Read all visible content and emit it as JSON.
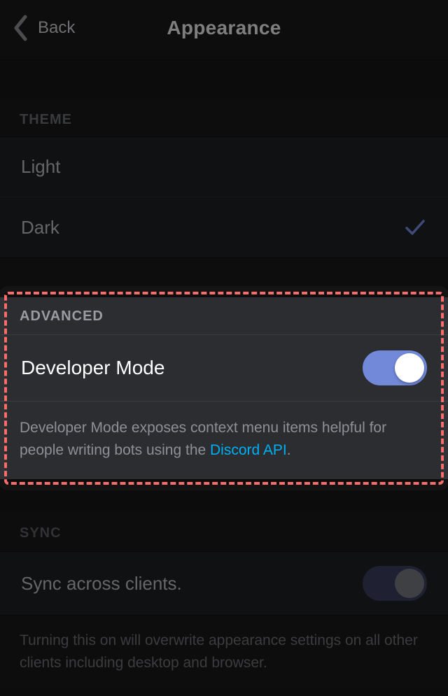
{
  "header": {
    "back_label": "Back",
    "title": "Appearance"
  },
  "theme": {
    "section_label": "THEME",
    "options": [
      {
        "label": "Light",
        "selected": false
      },
      {
        "label": "Dark",
        "selected": true
      }
    ]
  },
  "advanced": {
    "section_label": "ADVANCED",
    "developer_mode": {
      "label": "Developer Mode",
      "enabled": true,
      "desc_prefix": "Developer Mode exposes context menu items helpful for people writing bots using the ",
      "link_text": "Discord API",
      "desc_suffix": "."
    }
  },
  "sync": {
    "section_label": "SYNC",
    "label": "Sync across clients.",
    "enabled": false,
    "desc": "Turning this on will overwrite appearance settings on all other clients including desktop and browser."
  }
}
